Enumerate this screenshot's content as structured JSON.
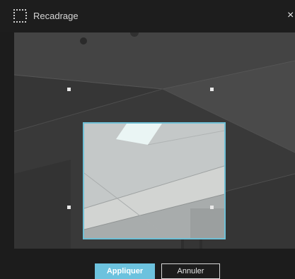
{
  "dialog": {
    "title": "Recadrage",
    "close_glyph": "×",
    "title_icon": "crop-frame-icon"
  },
  "actions": {
    "apply_label": "Appliquer",
    "cancel_label": "Annuler"
  },
  "colors": {
    "accent": "#6cc2de",
    "crop_border": "#6fc0d6",
    "background": "#1c1c1c"
  }
}
